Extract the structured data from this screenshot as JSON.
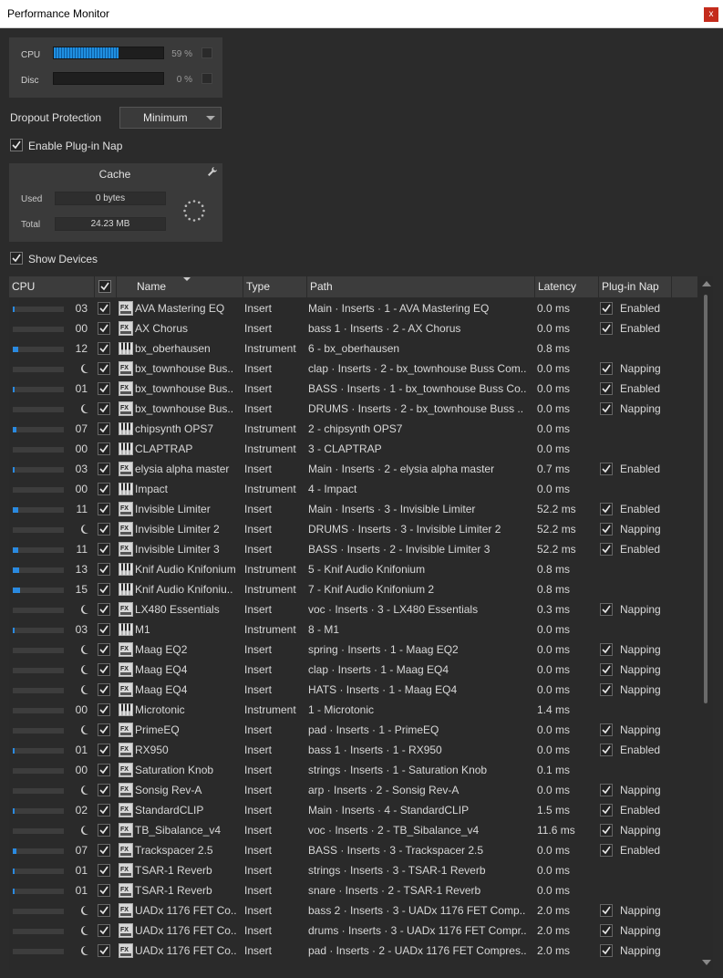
{
  "window": {
    "title": "Performance Monitor",
    "close_label": "x"
  },
  "meters": {
    "cpu_label": "CPU",
    "cpu_value": "59 %",
    "cpu_fraction": 0.59,
    "disc_label": "Disc",
    "disc_value": "0 %",
    "disc_fraction": 0.0
  },
  "dropout": {
    "label": "Dropout Protection",
    "value": "Minimum"
  },
  "plugin_nap": {
    "label": "Enable Plug-in Nap",
    "checked": true
  },
  "cache": {
    "title": "Cache",
    "used_label": "Used",
    "used_value": "0 bytes",
    "total_label": "Total",
    "total_value": "24.23 MB"
  },
  "show_devices": {
    "label": "Show Devices",
    "checked": true
  },
  "table": {
    "headers": {
      "cpu": "CPU",
      "name": "Name",
      "type": "Type",
      "path": "Path",
      "latency": "Latency",
      "nap": "Plug-in Nap"
    },
    "rows": [
      {
        "cpu": "03",
        "load": 0.03,
        "nap_icon": false,
        "icon": "fx",
        "name": "AVA Mastering EQ",
        "type": "Insert",
        "path": "Main · Inserts · 1 - AVA Mastering EQ",
        "latency": "0.0 ms",
        "nap": "Enabled",
        "nap_checked": true
      },
      {
        "cpu": "00",
        "load": 0.0,
        "nap_icon": false,
        "icon": "fx",
        "name": "AX Chorus",
        "type": "Insert",
        "path": "bass 1 · Inserts · 2 - AX Chorus",
        "latency": "0.0 ms",
        "nap": "Enabled",
        "nap_checked": true
      },
      {
        "cpu": "12",
        "load": 0.12,
        "nap_icon": false,
        "icon": "instrument",
        "name": "bx_oberhausen",
        "type": "Instrument",
        "path": "6 - bx_oberhausen",
        "latency": "0.8 ms",
        "nap": "",
        "nap_checked": false
      },
      {
        "cpu": "",
        "load": 0.0,
        "nap_icon": true,
        "icon": "fx",
        "name": "bx_townhouse Bus..",
        "type": "Insert",
        "path": "clap · Inserts · 2 - bx_townhouse Buss Com..",
        "latency": "0.0 ms",
        "nap": "Napping",
        "nap_checked": true
      },
      {
        "cpu": "01",
        "load": 0.01,
        "nap_icon": false,
        "icon": "fx",
        "name": "bx_townhouse Bus..",
        "type": "Insert",
        "path": "BASS · Inserts · 1 - bx_townhouse Buss Co..",
        "latency": "0.0 ms",
        "nap": "Enabled",
        "nap_checked": true
      },
      {
        "cpu": "",
        "load": 0.0,
        "nap_icon": true,
        "icon": "fx",
        "name": "bx_townhouse Bus..",
        "type": "Insert",
        "path": "DRUMS · Inserts · 2 - bx_townhouse Buss ..",
        "latency": "0.0 ms",
        "nap": "Napping",
        "nap_checked": true
      },
      {
        "cpu": "07",
        "load": 0.07,
        "nap_icon": false,
        "icon": "instrument",
        "name": "chipsynth OPS7",
        "type": "Instrument",
        "path": "2 - chipsynth OPS7",
        "latency": "0.0 ms",
        "nap": "",
        "nap_checked": false
      },
      {
        "cpu": "00",
        "load": 0.0,
        "nap_icon": false,
        "icon": "instrument",
        "name": "CLAPTRAP",
        "type": "Instrument",
        "path": "3 - CLAPTRAP",
        "latency": "0.0 ms",
        "nap": "",
        "nap_checked": false
      },
      {
        "cpu": "03",
        "load": 0.03,
        "nap_icon": false,
        "icon": "fx",
        "name": "elysia alpha master",
        "type": "Insert",
        "path": "Main · Inserts · 2 - elysia alpha master",
        "latency": "0.7 ms",
        "nap": "Enabled",
        "nap_checked": true
      },
      {
        "cpu": "00",
        "load": 0.0,
        "nap_icon": false,
        "icon": "instrument",
        "name": "Impact",
        "type": "Instrument",
        "path": "4 - Impact",
        "latency": "0.0 ms",
        "nap": "",
        "nap_checked": false
      },
      {
        "cpu": "11",
        "load": 0.11,
        "nap_icon": false,
        "icon": "fx",
        "name": "Invisible Limiter",
        "type": "Insert",
        "path": "Main · Inserts · 3 - Invisible Limiter",
        "latency": "52.2 ms",
        "nap": "Enabled",
        "nap_checked": true
      },
      {
        "cpu": "",
        "load": 0.0,
        "nap_icon": true,
        "icon": "fx",
        "name": "Invisible Limiter 2",
        "type": "Insert",
        "path": "DRUMS · Inserts · 3 - Invisible Limiter 2",
        "latency": "52.2 ms",
        "nap": "Napping",
        "nap_checked": true
      },
      {
        "cpu": "11",
        "load": 0.11,
        "nap_icon": false,
        "icon": "fx",
        "name": "Invisible Limiter 3",
        "type": "Insert",
        "path": "BASS · Inserts · 2 - Invisible Limiter 3",
        "latency": "52.2 ms",
        "nap": "Enabled",
        "nap_checked": true
      },
      {
        "cpu": "13",
        "load": 0.13,
        "nap_icon": false,
        "icon": "instrument",
        "name": "Knif Audio Knifonium",
        "type": "Instrument",
        "path": "5 - Knif Audio Knifonium",
        "latency": "0.8 ms",
        "nap": "",
        "nap_checked": false
      },
      {
        "cpu": "15",
        "load": 0.15,
        "nap_icon": false,
        "icon": "instrument",
        "name": "Knif Audio Knifoniu..",
        "type": "Instrument",
        "path": "7 - Knif Audio Knifonium 2",
        "latency": "0.8 ms",
        "nap": "",
        "nap_checked": false
      },
      {
        "cpu": "",
        "load": 0.0,
        "nap_icon": true,
        "icon": "fx",
        "name": "LX480 Essentials",
        "type": "Insert",
        "path": "voc · Inserts · 3 - LX480 Essentials",
        "latency": "0.3 ms",
        "nap": "Napping",
        "nap_checked": true
      },
      {
        "cpu": "03",
        "load": 0.03,
        "nap_icon": false,
        "icon": "instrument",
        "name": "M1",
        "type": "Instrument",
        "path": "8 - M1",
        "latency": "0.0 ms",
        "nap": "",
        "nap_checked": false
      },
      {
        "cpu": "",
        "load": 0.0,
        "nap_icon": true,
        "icon": "fx",
        "name": "Maag EQ2",
        "type": "Insert",
        "path": "spring · Inserts · 1 - Maag EQ2",
        "latency": "0.0 ms",
        "nap": "Napping",
        "nap_checked": true
      },
      {
        "cpu": "",
        "load": 0.0,
        "nap_icon": true,
        "icon": "fx",
        "name": "Maag EQ4",
        "type": "Insert",
        "path": "clap · Inserts · 1 - Maag EQ4",
        "latency": "0.0 ms",
        "nap": "Napping",
        "nap_checked": true
      },
      {
        "cpu": "",
        "load": 0.0,
        "nap_icon": true,
        "icon": "fx",
        "name": "Maag EQ4",
        "type": "Insert",
        "path": "HATS · Inserts · 1 - Maag EQ4",
        "latency": "0.0 ms",
        "nap": "Napping",
        "nap_checked": true
      },
      {
        "cpu": "00",
        "load": 0.0,
        "nap_icon": false,
        "icon": "instrument",
        "name": "Microtonic",
        "type": "Instrument",
        "path": "1 - Microtonic",
        "latency": "1.4 ms",
        "nap": "",
        "nap_checked": false
      },
      {
        "cpu": "",
        "load": 0.0,
        "nap_icon": true,
        "icon": "fx",
        "name": "PrimeEQ",
        "type": "Insert",
        "path": "pad · Inserts · 1 - PrimeEQ",
        "latency": "0.0 ms",
        "nap": "Napping",
        "nap_checked": true
      },
      {
        "cpu": "01",
        "load": 0.01,
        "nap_icon": false,
        "icon": "fx",
        "name": "RX950",
        "type": "Insert",
        "path": "bass 1 · Inserts · 1 - RX950",
        "latency": "0.0 ms",
        "nap": "Enabled",
        "nap_checked": true
      },
      {
        "cpu": "00",
        "load": 0.0,
        "nap_icon": false,
        "icon": "fx",
        "name": "Saturation Knob",
        "type": "Insert",
        "path": "strings · Inserts · 1 - Saturation Knob",
        "latency": "0.1 ms",
        "nap": "",
        "nap_checked": false
      },
      {
        "cpu": "",
        "load": 0.0,
        "nap_icon": true,
        "icon": "fx",
        "name": "Sonsig Rev-A",
        "type": "Insert",
        "path": "arp · Inserts · 2 - Sonsig Rev-A",
        "latency": "0.0 ms",
        "nap": "Napping",
        "nap_checked": true
      },
      {
        "cpu": "02",
        "load": 0.02,
        "nap_icon": false,
        "icon": "fx",
        "name": "StandardCLIP",
        "type": "Insert",
        "path": "Main · Inserts · 4 - StandardCLIP",
        "latency": "1.5 ms",
        "nap": "Enabled",
        "nap_checked": true
      },
      {
        "cpu": "",
        "load": 0.0,
        "nap_icon": true,
        "icon": "fx",
        "name": "TB_Sibalance_v4",
        "type": "Insert",
        "path": "voc · Inserts · 2 - TB_Sibalance_v4",
        "latency": "11.6 ms",
        "nap": "Napping",
        "nap_checked": true
      },
      {
        "cpu": "07",
        "load": 0.07,
        "nap_icon": false,
        "icon": "fx",
        "name": "Trackspacer 2.5",
        "type": "Insert",
        "path": "BASS · Inserts · 3 - Trackspacer 2.5",
        "latency": "0.0 ms",
        "nap": "Enabled",
        "nap_checked": true
      },
      {
        "cpu": "01",
        "load": 0.01,
        "nap_icon": false,
        "icon": "fx",
        "name": "TSAR-1 Reverb",
        "type": "Insert",
        "path": "strings · Inserts · 3 - TSAR-1 Reverb",
        "latency": "0.0 ms",
        "nap": "",
        "nap_checked": false
      },
      {
        "cpu": "01",
        "load": 0.01,
        "nap_icon": false,
        "icon": "fx",
        "name": "TSAR-1 Reverb",
        "type": "Insert",
        "path": "snare · Inserts · 2 - TSAR-1 Reverb",
        "latency": "0.0 ms",
        "nap": "",
        "nap_checked": false
      },
      {
        "cpu": "",
        "load": 0.0,
        "nap_icon": true,
        "icon": "fx",
        "name": "UADx 1176 FET Co..",
        "type": "Insert",
        "path": "bass 2 · Inserts · 3 - UADx 1176 FET Comp..",
        "latency": "2.0 ms",
        "nap": "Napping",
        "nap_checked": true
      },
      {
        "cpu": "",
        "load": 0.0,
        "nap_icon": true,
        "icon": "fx",
        "name": "UADx 1176 FET Co..",
        "type": "Insert",
        "path": "drums · Inserts · 3 - UADx 1176 FET Compr..",
        "latency": "2.0 ms",
        "nap": "Napping",
        "nap_checked": true
      },
      {
        "cpu": "",
        "load": 0.0,
        "nap_icon": true,
        "icon": "fx",
        "name": "UADx 1176 FET Co..",
        "type": "Insert",
        "path": "pad · Inserts · 2 - UADx 1176 FET Compres..",
        "latency": "2.0 ms",
        "nap": "Napping",
        "nap_checked": true
      }
    ]
  }
}
